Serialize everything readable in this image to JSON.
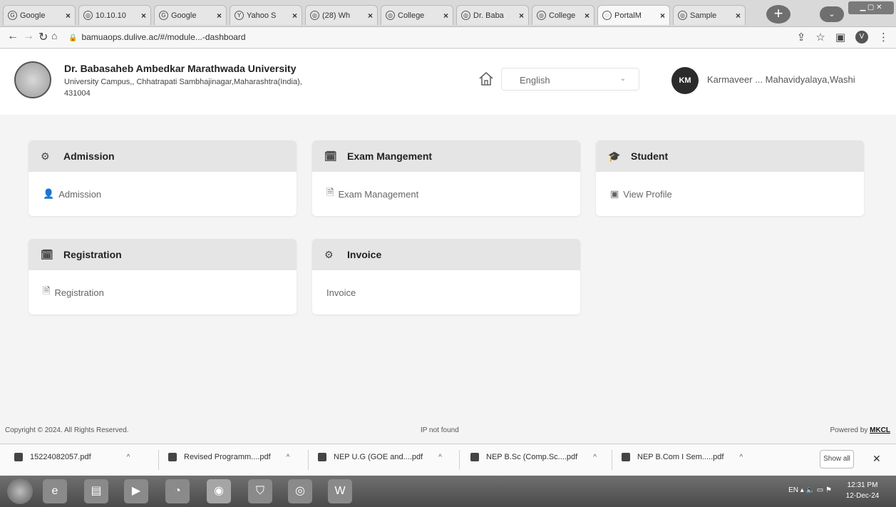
{
  "browser": {
    "tabs": [
      {
        "icon": "G",
        "title": "Google",
        "active": false
      },
      {
        "icon": "◎",
        "title": "10.10.10",
        "active": false
      },
      {
        "icon": "G",
        "title": "Google",
        "active": false
      },
      {
        "icon": "Y",
        "title": "Yahoo S",
        "active": false
      },
      {
        "icon": "◎",
        "title": "(28) Wh",
        "active": false
      },
      {
        "icon": "◎",
        "title": "College",
        "active": false
      },
      {
        "icon": "◎",
        "title": "Dr. Baba",
        "active": false
      },
      {
        "icon": "◎",
        "title": "College",
        "active": false
      },
      {
        "icon": "◌",
        "title": "PortalM",
        "active": true
      },
      {
        "icon": "◎",
        "title": "Sample",
        "active": false
      }
    ],
    "new_tab_label": "+",
    "url": "bamuaops.dulive.ac/#/module...-dashboard",
    "profile_initial": "V"
  },
  "header": {
    "university_name": "Dr. Babasaheb Ambedkar Marathwada University",
    "address_line": "University Campus,, Chhatrapati Sambhajinagar,Maharashtra(India),",
    "pincode": "431004",
    "language_selected": "English",
    "user_initials": "KM",
    "user_name": "Karmaveer ... Mahavidyalaya,Washi"
  },
  "cards": [
    {
      "title": "Admission",
      "icon": "⚙",
      "item": "Admission",
      "item_icon": "👤"
    },
    {
      "title": "Exam Mangement",
      "icon": "🗓",
      "item": "Exam Management",
      "item_icon": "🗎"
    },
    {
      "title": "Student",
      "icon": "🎓",
      "item": "View Profile",
      "item_icon": "▣"
    },
    {
      "title": "Registration",
      "icon": "🗓",
      "item": "Registration",
      "item_icon": "🗎"
    },
    {
      "title": "Invoice",
      "icon": "⚙",
      "item": "Invoice",
      "item_icon": ""
    }
  ],
  "footer": {
    "copyright": "Copyright © 2024. All Rights Reserved.",
    "ip": "IP not found",
    "powered_by": "Powered by",
    "powered_brand": "MKCL"
  },
  "downloads": {
    "items": [
      "15224082057.pdf",
      "Revised Programm....pdf",
      "NEP U.G (GOE and....pdf",
      "NEP B.Sc (Comp.Sc....pdf",
      "NEP B.Com I Sem.....pdf"
    ],
    "show_all": "Show all",
    "close": "✕"
  },
  "taskbar": {
    "language": "EN",
    "time": "12:31 PM",
    "date": "12-Dec-24"
  }
}
